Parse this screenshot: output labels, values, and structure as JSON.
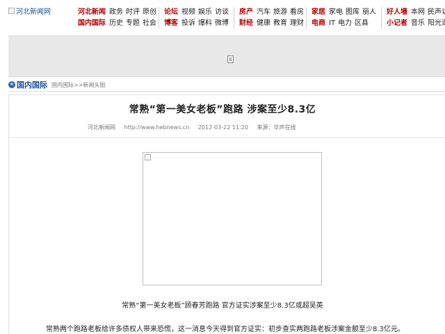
{
  "header": {
    "logo_alt": "河北新闻网",
    "nav_groups": [
      {
        "rows": [
          {
            "head": "河北新闻",
            "items": [
              "政务",
              "时评",
              "原创"
            ]
          },
          {
            "head": "国内国际",
            "items": [
              "历史",
              "专题",
              "社会"
            ]
          }
        ]
      },
      {
        "rows": [
          {
            "head": "论坛",
            "items": [
              "视频",
              "娱乐",
              "访谈"
            ]
          },
          {
            "head": "博客",
            "items": [
              "投诉",
              "爆料",
              "微博"
            ]
          }
        ]
      },
      {
        "rows": [
          {
            "head": "房产",
            "items": [
              "汽车",
              "旅游",
              "看房"
            ]
          },
          {
            "head": "财经",
            "items": [
              "健康",
              "教育",
              "理财"
            ]
          }
        ]
      },
      {
        "rows": [
          {
            "head": "家居",
            "items": [
              "家电",
              "图库",
              "丽人"
            ]
          },
          {
            "head": "电商",
            "items": [
              "IT",
              "电力",
              "区县"
            ]
          }
        ]
      },
      {
        "rows": [
          {
            "head": "好人墙",
            "items": [
              "本网",
              "民声访"
            ]
          },
          {
            "head": "小记者",
            "items": [
              "音乐",
              "阳光课"
            ]
          }
        ]
      }
    ]
  },
  "breadcrumb": {
    "section": "国内国际",
    "path": "国内国际>>新闻头图"
  },
  "article": {
    "title": "常熟“第一美女老板”跑路 涉案至少8.3亿",
    "source": "河北新闻网",
    "url": "http://www.hebnews.cn",
    "datetime": "2012-03-22 11:20",
    "origin": "来源：华声在线",
    "caption": "常熟“第一美女老板”顾春芳跑路 官方证实涉案至少8.3亿或超吴英",
    "paragraph": "常熟两个跑路老板给许多债权人带来恐慌，这一消息今天得到官方证实：初步查实两跑路老板涉案金额至少8.3亿元。"
  }
}
